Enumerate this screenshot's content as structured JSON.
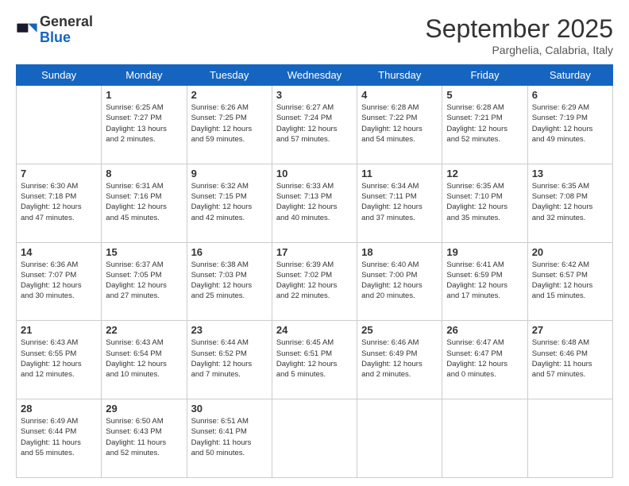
{
  "header": {
    "logo_general": "General",
    "logo_blue": "Blue",
    "title": "September 2025",
    "location": "Parghelia, Calabria, Italy"
  },
  "columns": [
    "Sunday",
    "Monday",
    "Tuesday",
    "Wednesday",
    "Thursday",
    "Friday",
    "Saturday"
  ],
  "weeks": [
    [
      {
        "day": "",
        "info": ""
      },
      {
        "day": "1",
        "info": "Sunrise: 6:25 AM\nSunset: 7:27 PM\nDaylight: 13 hours\nand 2 minutes."
      },
      {
        "day": "2",
        "info": "Sunrise: 6:26 AM\nSunset: 7:25 PM\nDaylight: 12 hours\nand 59 minutes."
      },
      {
        "day": "3",
        "info": "Sunrise: 6:27 AM\nSunset: 7:24 PM\nDaylight: 12 hours\nand 57 minutes."
      },
      {
        "day": "4",
        "info": "Sunrise: 6:28 AM\nSunset: 7:22 PM\nDaylight: 12 hours\nand 54 minutes."
      },
      {
        "day": "5",
        "info": "Sunrise: 6:28 AM\nSunset: 7:21 PM\nDaylight: 12 hours\nand 52 minutes."
      },
      {
        "day": "6",
        "info": "Sunrise: 6:29 AM\nSunset: 7:19 PM\nDaylight: 12 hours\nand 49 minutes."
      }
    ],
    [
      {
        "day": "7",
        "info": "Sunrise: 6:30 AM\nSunset: 7:18 PM\nDaylight: 12 hours\nand 47 minutes."
      },
      {
        "day": "8",
        "info": "Sunrise: 6:31 AM\nSunset: 7:16 PM\nDaylight: 12 hours\nand 45 minutes."
      },
      {
        "day": "9",
        "info": "Sunrise: 6:32 AM\nSunset: 7:15 PM\nDaylight: 12 hours\nand 42 minutes."
      },
      {
        "day": "10",
        "info": "Sunrise: 6:33 AM\nSunset: 7:13 PM\nDaylight: 12 hours\nand 40 minutes."
      },
      {
        "day": "11",
        "info": "Sunrise: 6:34 AM\nSunset: 7:11 PM\nDaylight: 12 hours\nand 37 minutes."
      },
      {
        "day": "12",
        "info": "Sunrise: 6:35 AM\nSunset: 7:10 PM\nDaylight: 12 hours\nand 35 minutes."
      },
      {
        "day": "13",
        "info": "Sunrise: 6:35 AM\nSunset: 7:08 PM\nDaylight: 12 hours\nand 32 minutes."
      }
    ],
    [
      {
        "day": "14",
        "info": "Sunrise: 6:36 AM\nSunset: 7:07 PM\nDaylight: 12 hours\nand 30 minutes."
      },
      {
        "day": "15",
        "info": "Sunrise: 6:37 AM\nSunset: 7:05 PM\nDaylight: 12 hours\nand 27 minutes."
      },
      {
        "day": "16",
        "info": "Sunrise: 6:38 AM\nSunset: 7:03 PM\nDaylight: 12 hours\nand 25 minutes."
      },
      {
        "day": "17",
        "info": "Sunrise: 6:39 AM\nSunset: 7:02 PM\nDaylight: 12 hours\nand 22 minutes."
      },
      {
        "day": "18",
        "info": "Sunrise: 6:40 AM\nSunset: 7:00 PM\nDaylight: 12 hours\nand 20 minutes."
      },
      {
        "day": "19",
        "info": "Sunrise: 6:41 AM\nSunset: 6:59 PM\nDaylight: 12 hours\nand 17 minutes."
      },
      {
        "day": "20",
        "info": "Sunrise: 6:42 AM\nSunset: 6:57 PM\nDaylight: 12 hours\nand 15 minutes."
      }
    ],
    [
      {
        "day": "21",
        "info": "Sunrise: 6:43 AM\nSunset: 6:55 PM\nDaylight: 12 hours\nand 12 minutes."
      },
      {
        "day": "22",
        "info": "Sunrise: 6:43 AM\nSunset: 6:54 PM\nDaylight: 12 hours\nand 10 minutes."
      },
      {
        "day": "23",
        "info": "Sunrise: 6:44 AM\nSunset: 6:52 PM\nDaylight: 12 hours\nand 7 minutes."
      },
      {
        "day": "24",
        "info": "Sunrise: 6:45 AM\nSunset: 6:51 PM\nDaylight: 12 hours\nand 5 minutes."
      },
      {
        "day": "25",
        "info": "Sunrise: 6:46 AM\nSunset: 6:49 PM\nDaylight: 12 hours\nand 2 minutes."
      },
      {
        "day": "26",
        "info": "Sunrise: 6:47 AM\nSunset: 6:47 PM\nDaylight: 12 hours\nand 0 minutes."
      },
      {
        "day": "27",
        "info": "Sunrise: 6:48 AM\nSunset: 6:46 PM\nDaylight: 11 hours\nand 57 minutes."
      }
    ],
    [
      {
        "day": "28",
        "info": "Sunrise: 6:49 AM\nSunset: 6:44 PM\nDaylight: 11 hours\nand 55 minutes."
      },
      {
        "day": "29",
        "info": "Sunrise: 6:50 AM\nSunset: 6:43 PM\nDaylight: 11 hours\nand 52 minutes."
      },
      {
        "day": "30",
        "info": "Sunrise: 6:51 AM\nSunset: 6:41 PM\nDaylight: 11 hours\nand 50 minutes."
      },
      {
        "day": "",
        "info": ""
      },
      {
        "day": "",
        "info": ""
      },
      {
        "day": "",
        "info": ""
      },
      {
        "day": "",
        "info": ""
      }
    ]
  ]
}
